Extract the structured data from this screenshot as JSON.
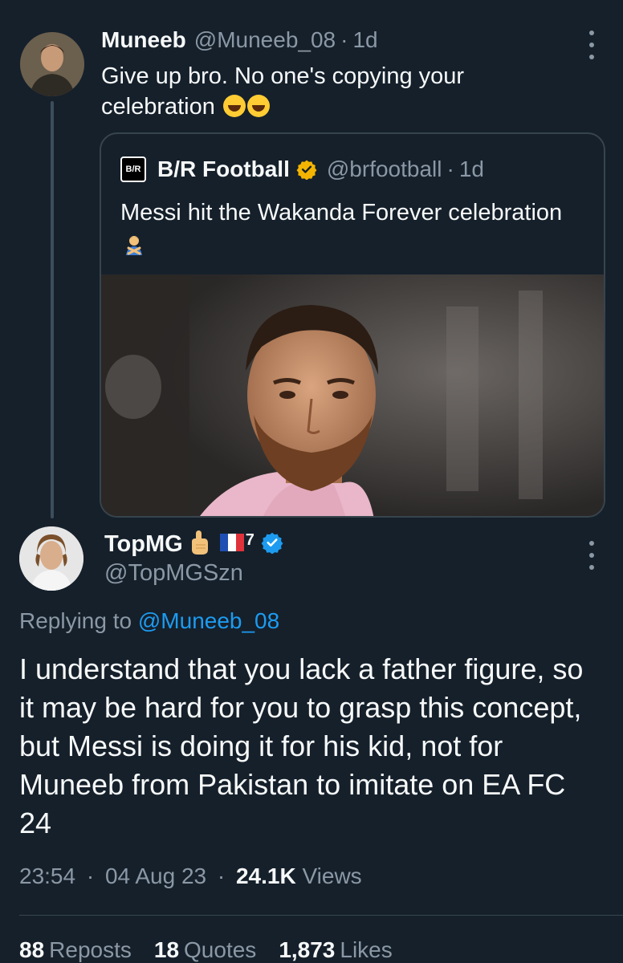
{
  "parent_tweet": {
    "author_name": "Muneeb",
    "author_handle": "@Muneeb_08",
    "separator": "·",
    "time": "1d",
    "text": "Give up bro. No one's copying your celebration",
    "quoted_tweet": {
      "author_name": "B/R Football",
      "logo_text": "B/R",
      "author_handle": "@brfootball",
      "separator": "·",
      "time": "1d",
      "text": "Messi hit the Wakanda Forever celebration"
    }
  },
  "reply_tweet": {
    "author_name": "TopMG",
    "superscript": "7",
    "author_handle": "@TopMGSzn",
    "replying_prefix": "Replying to",
    "replying_mention": "@Muneeb_08",
    "text": "I understand that you lack a father figure, so it may be hard for you to grasp this concept, but Messi is doing it for his kid, not for Muneeb from Pakistan to imitate on EA FC 24",
    "time": "23:54",
    "date": "04 Aug 23",
    "separator": "·",
    "views_count": "24.1K",
    "views_label": "Views",
    "stats": {
      "reposts_count": "88",
      "reposts_label": "Reposts",
      "quotes_count": "18",
      "quotes_label": "Quotes",
      "likes_count": "1,873",
      "likes_label": "Likes"
    }
  },
  "colors": {
    "background": "#15202b",
    "text_primary": "#f7f9f9",
    "text_secondary": "#8b98a5",
    "accent": "#1d9bf0",
    "gold_verified": "#f4b400",
    "border": "#38444d"
  }
}
